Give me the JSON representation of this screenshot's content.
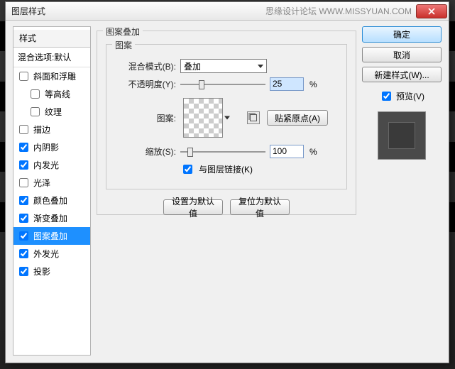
{
  "titlebar": {
    "title": "图层样式",
    "watermark": "思缘设计论坛  WWW.MISSYUAN.COM"
  },
  "styles": {
    "header": "样式",
    "blend_options": "混合选项:默认",
    "items": [
      {
        "label": "斜面和浮雕",
        "checked": false
      },
      {
        "label": "等高线",
        "checked": false,
        "sub": true
      },
      {
        "label": "纹理",
        "checked": false,
        "sub": true
      },
      {
        "label": "描边",
        "checked": false
      },
      {
        "label": "内阴影",
        "checked": true
      },
      {
        "label": "内发光",
        "checked": true
      },
      {
        "label": "光泽",
        "checked": false
      },
      {
        "label": "颜色叠加",
        "checked": true
      },
      {
        "label": "渐变叠加",
        "checked": true
      },
      {
        "label": "图案叠加",
        "checked": true,
        "selected": true
      },
      {
        "label": "外发光",
        "checked": true
      },
      {
        "label": "投影",
        "checked": true
      }
    ]
  },
  "panel": {
    "title": "图案叠加",
    "pattern_group": "图案",
    "blend_mode_label": "混合模式(B):",
    "blend_mode_value": "叠加",
    "opacity_label": "不透明度(Y):",
    "opacity_value": "25",
    "pattern_label": "图案:",
    "snap_label": "贴紧原点(A)",
    "scale_label": "缩放(S):",
    "scale_value": "100",
    "link_label": "与图层链接(K)",
    "percent": "%",
    "set_default": "设置为默认值",
    "reset_default": "复位为默认值"
  },
  "right": {
    "ok": "确定",
    "cancel": "取消",
    "new_style": "新建样式(W)...",
    "preview": "预览(V)"
  }
}
